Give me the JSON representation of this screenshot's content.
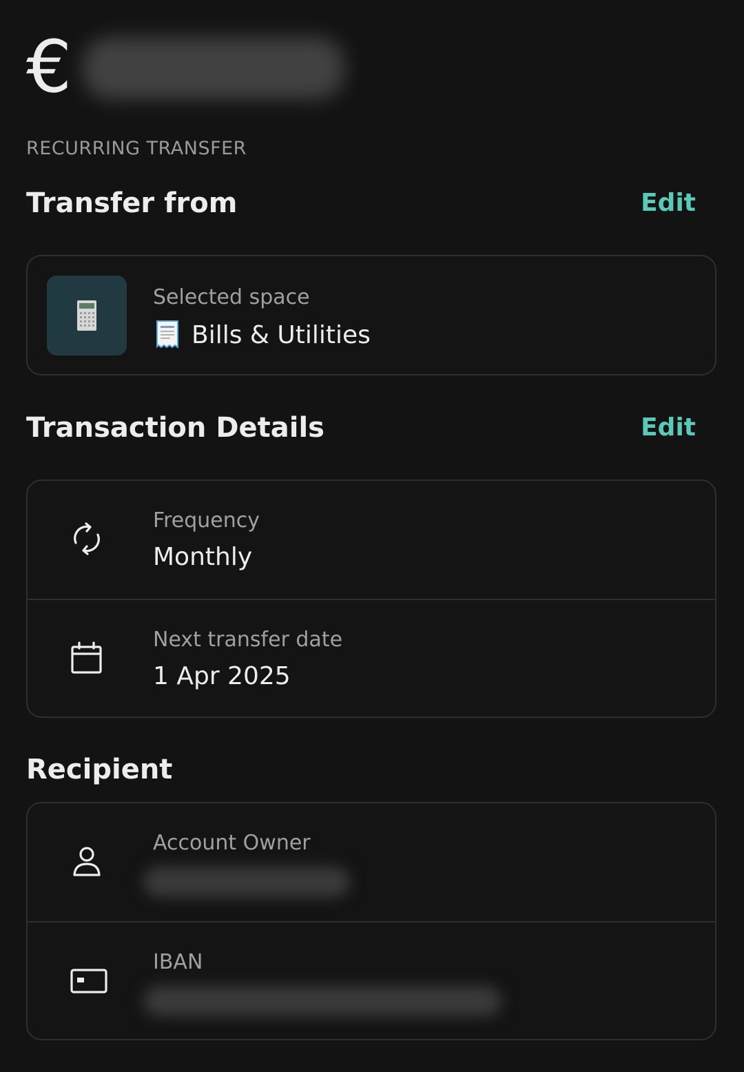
{
  "header": {
    "currency_symbol": "€",
    "amount": ""
  },
  "overline": "RECURRING TRANSFER",
  "transfer_from": {
    "title": "Transfer from",
    "edit_label": "Edit",
    "space_label": "Selected space",
    "space_name": "Bills & Utilities",
    "space_icon": "calculator-icon",
    "space_emoji_icon": "receipt-icon",
    "space_avatar_color": "#213a42"
  },
  "transaction_details": {
    "title": "Transaction Details",
    "edit_label": "Edit",
    "rows": [
      {
        "icon": "repeat-icon",
        "label": "Frequency",
        "value": "Monthly"
      },
      {
        "icon": "calendar-icon",
        "label": "Next transfer date",
        "value": "1 Apr 2025"
      }
    ]
  },
  "recipient": {
    "title": "Recipient",
    "rows": [
      {
        "icon": "person-icon",
        "label": "Account Owner",
        "value": ""
      },
      {
        "icon": "card-icon",
        "label": "IBAN",
        "value": ""
      }
    ]
  },
  "colors": {
    "background": "#131313",
    "accent": "#5cc8b8",
    "border": "#2f2f2f",
    "muted_text": "#a0a0a0",
    "primary_text": "#ededed"
  }
}
